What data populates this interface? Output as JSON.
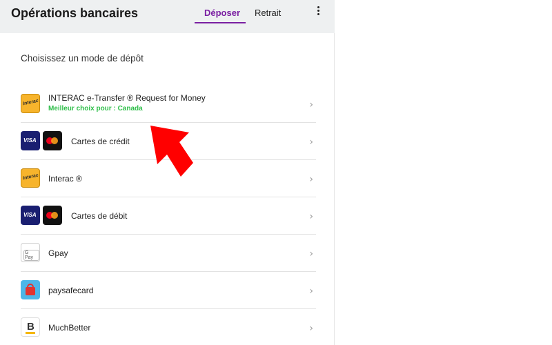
{
  "header": {
    "title": "Opérations bancaires",
    "tabs": [
      {
        "label": "Déposer",
        "active": true
      },
      {
        "label": "Retrait",
        "active": false
      }
    ]
  },
  "main": {
    "subtitle": "Choisissez un mode de dépôt",
    "methods": [
      {
        "label": "INTERAC e-Transfer ® Request for Money",
        "sub": "Meilleur choix pour : Canada",
        "icons": [
          "interac-icon"
        ]
      },
      {
        "label": "Cartes de crédit",
        "icons": [
          "visa-icon",
          "mastercard-icon"
        ]
      },
      {
        "label": "Interac ®",
        "icons": [
          "interac-icon"
        ]
      },
      {
        "label": "Cartes de débit",
        "icons": [
          "visa-icon",
          "mastercard-icon"
        ]
      },
      {
        "label": "Gpay",
        "icons": [
          "gpay-icon"
        ]
      },
      {
        "label": "paysafecard",
        "icons": [
          "paysafecard-icon"
        ]
      },
      {
        "label": "MuchBetter",
        "icons": [
          "muchbetter-icon"
        ]
      }
    ],
    "chevron": "›"
  },
  "icon_text": {
    "interac": "Interac",
    "visa": "VISA",
    "gpay": "G Pay",
    "muchbetter": "B"
  },
  "colors": {
    "accent": "#7a1fa2",
    "highlight_green": "#2fbf4a",
    "arrow": "#ff0000",
    "header_bg": "#eef0f1"
  }
}
